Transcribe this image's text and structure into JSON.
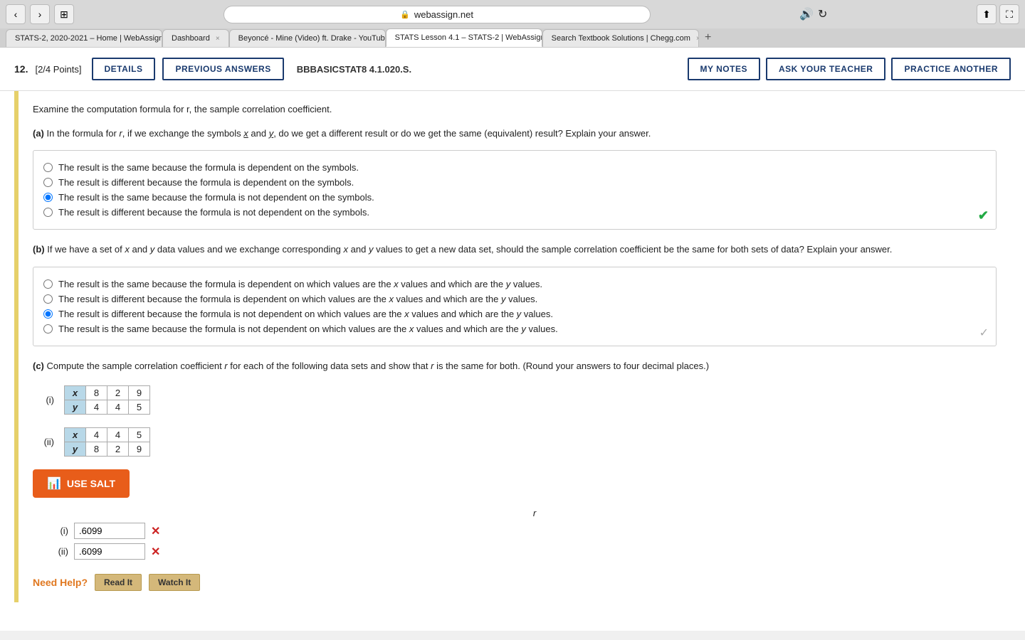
{
  "browser": {
    "address": "webassign.net",
    "lock_icon": "🔒",
    "tabs": [
      {
        "id": "tab1",
        "label": "STATS-2, 2020-2021 – Home | WebAssign",
        "active": false,
        "sound": false
      },
      {
        "id": "tab2",
        "label": "Dashboard",
        "active": false,
        "sound": false
      },
      {
        "id": "tab3",
        "label": "Beyoncé - Mine (Video) ft. Drake - YouTube",
        "active": false,
        "sound": true
      },
      {
        "id": "tab4",
        "label": "STATS Lesson 4.1 – STATS-2 | WebAssign",
        "active": true,
        "sound": false
      },
      {
        "id": "tab5",
        "label": "Search Textbook Solutions | Chegg.com",
        "active": false,
        "sound": false
      }
    ]
  },
  "header": {
    "question_number": "12.",
    "points": "[2/4 Points]",
    "details_label": "DETAILS",
    "prev_answers_label": "PREVIOUS ANSWERS",
    "problem_code": "BBBASICSTAT8 4.1.020.S.",
    "my_notes_label": "MY NOTES",
    "ask_teacher_label": "ASK YOUR TEACHER",
    "practice_another_label": "PRACTICE ANOTHER"
  },
  "question": {
    "intro": "Examine the computation formula for r, the sample correlation coefficient.",
    "part_a": {
      "label": "(a)",
      "text": "In the formula for r, if we exchange the symbols x and y, do we get a different result or do we get the same (equivalent) result? Explain your answer.",
      "options": [
        {
          "id": "a1",
          "text": "The result is the same because the formula is dependent on the symbols.",
          "checked": false
        },
        {
          "id": "a2",
          "text": "The result is different because the formula is dependent on the symbols.",
          "checked": false
        },
        {
          "id": "a3",
          "text": "The result is the same because the formula is not dependent on the symbols.",
          "checked": true
        },
        {
          "id": "a4",
          "text": "The result is different because the formula is not dependent on the symbols.",
          "checked": false
        }
      ],
      "check_symbol": "✔"
    },
    "part_b": {
      "label": "(b)",
      "text": "If we have a set of x and y data values and we exchange corresponding x and y values to get a new data set, should the sample correlation coefficient be the same for both sets of data? Explain your answer.",
      "options": [
        {
          "id": "b1",
          "text": "The result is the same because the formula is dependent on which values are the x values and which are the y values.",
          "checked": false
        },
        {
          "id": "b2",
          "text": "The result is different because the formula is dependent on which values are the x values and which are the y values.",
          "checked": false
        },
        {
          "id": "b3",
          "text": "The result is different because the formula is not dependent on which values are the x values and which are the y values.",
          "checked": true
        },
        {
          "id": "b4",
          "text": "The result is the same because the formula is not dependent on which values are the x values and which are the y values.",
          "checked": false
        }
      ],
      "check_symbol": "✓"
    },
    "part_c": {
      "label": "(c)",
      "text": "Compute the sample correlation coefficient r for each of the following data sets and show that r is the same for both. (Round your answers to four decimal places.)",
      "dataset_i_label": "(i)",
      "dataset_i": {
        "x_label": "x",
        "x_values": [
          "8",
          "2",
          "9"
        ],
        "y_label": "y",
        "y_values": [
          "4",
          "4",
          "5"
        ]
      },
      "dataset_ii_label": "(ii)",
      "dataset_ii": {
        "x_label": "x",
        "x_values": [
          "4",
          "4",
          "5"
        ],
        "y_label": "y",
        "y_values": [
          "8",
          "2",
          "9"
        ]
      },
      "use_salt_label": "USE SALT",
      "r_column_label": "r",
      "answer_i_label": "(i)",
      "answer_i_value": ".6099",
      "answer_ii_label": "(ii)",
      "answer_ii_value": ".6099"
    }
  },
  "need_help": {
    "label": "Need Help?",
    "read_it_label": "Read It",
    "watch_it_label": "Watch It"
  },
  "icons": {
    "back": "‹",
    "forward": "›",
    "grid": "⊞",
    "sound": "🔊",
    "refresh": "↻",
    "share": "⬆",
    "fullscreen": "⛶",
    "wrong": "✕",
    "salt": "📊"
  }
}
